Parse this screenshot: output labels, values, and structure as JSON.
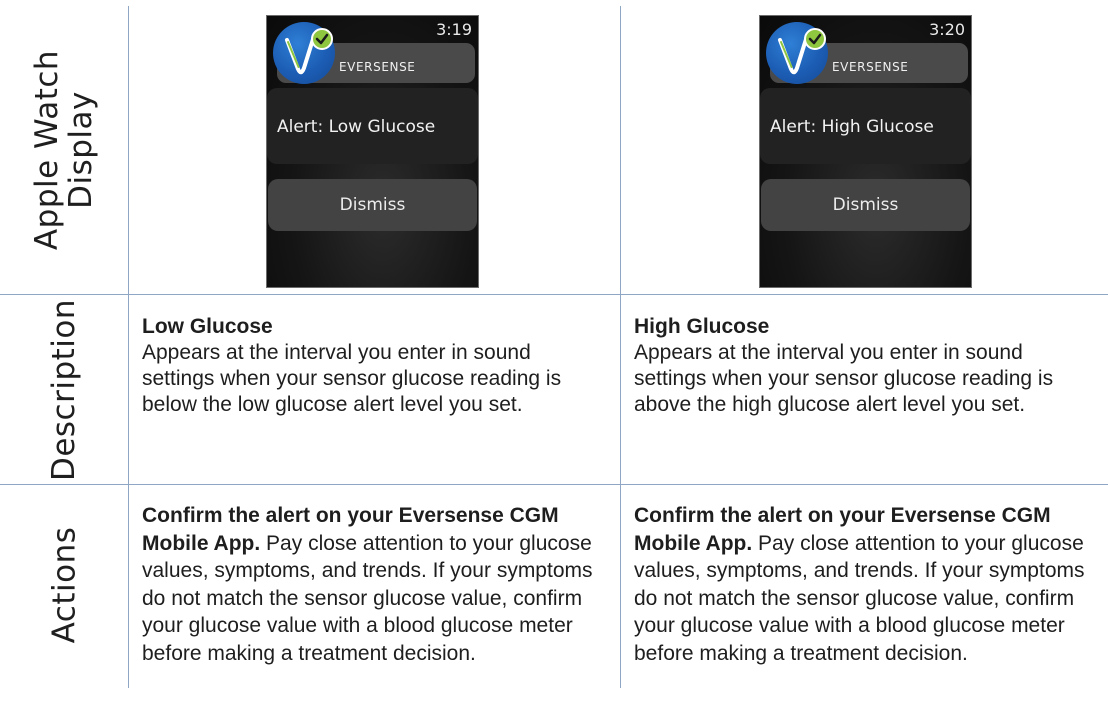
{
  "row_labels": {
    "display": [
      "Apple Watch",
      "Display"
    ],
    "description": "Description",
    "actions": "Actions"
  },
  "columns": [
    {
      "watch": {
        "time": "3:19",
        "app_name": "EVERSENSE",
        "alert": "Alert:  Low Glucose",
        "button": "Dismiss",
        "icon": "eversense-logo-icon",
        "colors": {
          "logo": "#1c5db4",
          "check": "#8ec63f"
        }
      },
      "description": {
        "title": "Low Glucose",
        "body": "Appears at the interval you enter in sound settings when your sensor glucose reading is below the low glucose alert level you set."
      },
      "actions": {
        "lead": "Confirm the alert on your Eversense CGM Mobile App.",
        "body": " Pay close attention to your glucose values, symptoms, and trends. If your symptoms do not match the sensor glucose value, confirm your glucose value with a blood glucose meter before making a treatment decision."
      }
    },
    {
      "watch": {
        "time": "3:20",
        "app_name": "EVERSENSE",
        "alert": "Alert:  High Glucose",
        "button": "Dismiss",
        "icon": "eversense-logo-icon",
        "colors": {
          "logo": "#1c5db4",
          "check": "#8ec63f"
        }
      },
      "description": {
        "title": "High Glucose",
        "body": "Appears at the interval you enter in sound settings when your sensor glucose reading is above the high glucose alert level you set."
      },
      "actions": {
        "lead": "Confirm the alert on your Eversense CGM Mobile App.",
        "body": " Pay close attention to your glucose values, symptoms, and trends. If your symptoms do not match the sensor glucose value, confirm your glucose value with a blood glucose meter before making a treatment decision."
      }
    }
  ],
  "border_color": "#8fa6c4"
}
